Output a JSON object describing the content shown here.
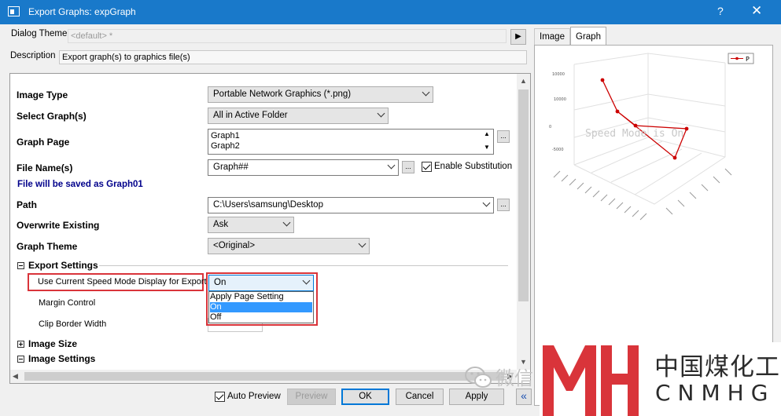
{
  "window": {
    "title": "Export Graphs: expGraph",
    "help_glyph": "?",
    "close_glyph": "✕"
  },
  "theme": {
    "label": "Dialog Theme",
    "value": "<default> *",
    "arrow": "▶"
  },
  "description": {
    "label": "Description",
    "value": "Export graph(s) to graphics file(s)"
  },
  "settings": {
    "image_type": {
      "label": "Image Type",
      "value": "Portable Network Graphics (*.png)"
    },
    "select_graphs": {
      "label": "Select Graph(s)",
      "value": "All in Active Folder"
    },
    "graph_page": {
      "label": "Graph Page",
      "items": [
        "Graph1",
        "Graph2"
      ],
      "button": "..."
    },
    "file_name": {
      "label": "File Name(s)",
      "value": "Graph##",
      "button": "...",
      "substitution_label": "Enable Substitution",
      "substitution_checked": true
    },
    "save_note": "File will be saved as Graph01",
    "path": {
      "label": "Path",
      "value": "C:\\Users\\samsung\\Desktop",
      "button": "..."
    },
    "overwrite": {
      "label": "Overwrite Existing",
      "value": "Ask"
    },
    "graph_theme": {
      "label": "Graph Theme",
      "value": "<Original>"
    },
    "export_settings": {
      "label": "Export Settings",
      "speed_mode": {
        "label": "Use Current Speed Mode Display for Export",
        "value": "On",
        "options": [
          "Apply Page Setting",
          "On",
          "Off"
        ],
        "selected": "On"
      },
      "margin_control": {
        "label": "Margin Control"
      },
      "clip_border": {
        "label": "Clip Border Width"
      }
    },
    "image_size": {
      "label": "Image Size"
    },
    "image_settings": {
      "label": "Image Settings"
    }
  },
  "buttons": {
    "auto_preview_label": "Auto Preview",
    "auto_preview_checked": true,
    "preview": "Preview",
    "ok": "OK",
    "cancel": "Cancel",
    "apply": "Apply",
    "collapse": "«"
  },
  "preview_tabs": [
    "Image",
    "Graph"
  ],
  "preview_graph": {
    "legend_label": "P",
    "speed_mode_text": "Speed Mode is On",
    "y_tick_labels": [
      "10000",
      "10000",
      "0",
      "-5000"
    ],
    "line_color": "#cc0000"
  },
  "watermark": {
    "wechat_text": "微信",
    "logo_cn": "中国煤化工",
    "logo_en": "CNMHG",
    "logo_color": "#d9343a"
  },
  "colors": {
    "titlebar": "#1979ca",
    "dropdown_highlight": "#3399ff",
    "highlight_box": "#d9343a",
    "note_text": "#00008b"
  }
}
